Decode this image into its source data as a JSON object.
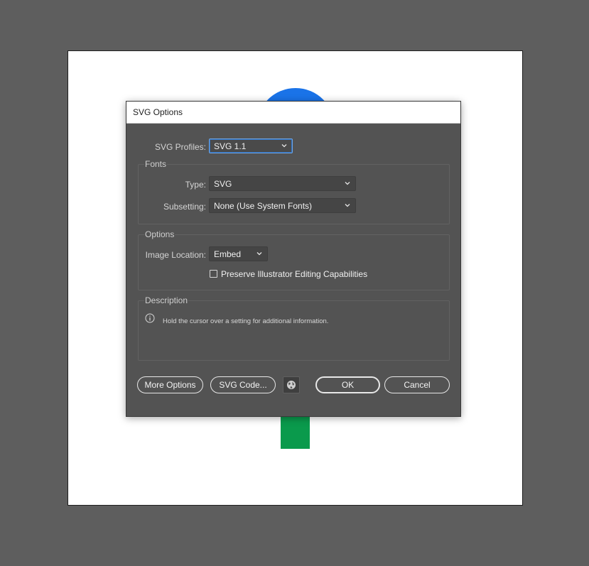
{
  "dialog": {
    "title": "SVG Options",
    "svg_profiles": {
      "label": "SVG Profiles:",
      "value": "SVG 1.1"
    },
    "fonts": {
      "group_label": "Fonts",
      "type": {
        "label": "Type:",
        "value": "SVG"
      },
      "subsetting": {
        "label": "Subsetting:",
        "value": "None (Use System Fonts)"
      }
    },
    "options": {
      "group_label": "Options",
      "image_location": {
        "label": "Image Location:",
        "value": "Embed"
      },
      "preserve": {
        "label": "Preserve Illustrator Editing Capabilities",
        "checked": false
      }
    },
    "description": {
      "group_label": "Description",
      "icon": "info-icon",
      "text": "Hold the cursor over a setting for additional information."
    },
    "buttons": {
      "more_options": "More Options",
      "svg_code": "SVG Code...",
      "web_preview_icon": "globe-icon",
      "ok": "OK",
      "cancel": "Cancel"
    }
  },
  "colors": {
    "canvas_background": "#5e5e5e",
    "artboard": "#ffffff",
    "blue_circle": "#1a73e8",
    "green_rect": "#0a9a4c",
    "dialog_background": "#535353"
  }
}
